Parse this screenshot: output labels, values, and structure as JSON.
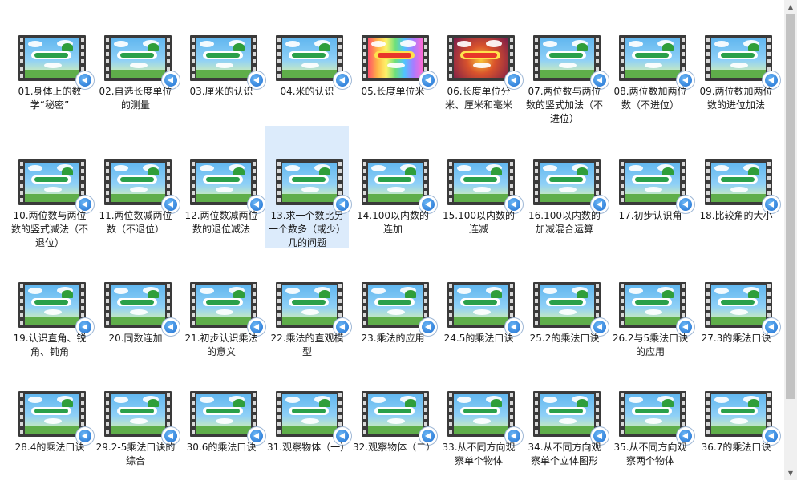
{
  "items": [
    {
      "label": "01.身体上的数学“秘密”",
      "style": "normal"
    },
    {
      "label": "02.自选长度单位的测量",
      "style": "normal"
    },
    {
      "label": "03.厘米的认识",
      "style": "normal"
    },
    {
      "label": "04.米的认识",
      "style": "normal"
    },
    {
      "label": "05.长度单位米",
      "style": "rainbow"
    },
    {
      "label": "06.长度单位分米、厘米和毫米",
      "style": "dark"
    },
    {
      "label": "07.两位数与两位数的竖式加法（不进位）",
      "style": "normal"
    },
    {
      "label": "08.两位数加两位数（不进位）",
      "style": "normal"
    },
    {
      "label": "09.两位数加两位数的进位加法",
      "style": "normal"
    },
    {
      "label": "10.两位数与两位数的竖式减法（不退位）",
      "style": "normal"
    },
    {
      "label": "11.两位数减两位数（不退位）",
      "style": "normal"
    },
    {
      "label": "12.两位数减两位数的退位减法",
      "style": "normal"
    },
    {
      "label": "13.求一个数比另一个数多（或少）几的问题",
      "style": "normal",
      "selected": true
    },
    {
      "label": "14.100以内数的连加",
      "style": "normal"
    },
    {
      "label": "15.100以内数的连减",
      "style": "normal"
    },
    {
      "label": "16.100以内数的加减混合运算",
      "style": "normal"
    },
    {
      "label": "17.初步认识角",
      "style": "normal"
    },
    {
      "label": "18.比较角的大小",
      "style": "normal"
    },
    {
      "label": "19.认识直角、锐角、钝角",
      "style": "normal"
    },
    {
      "label": "20.同数连加",
      "style": "normal"
    },
    {
      "label": "21.初步认识乘法的意义",
      "style": "normal"
    },
    {
      "label": "22.乘法的直观模型",
      "style": "normal"
    },
    {
      "label": "23.乘法的应用",
      "style": "normal"
    },
    {
      "label": "24.5的乘法口诀",
      "style": "normal"
    },
    {
      "label": "25.2的乘法口诀",
      "style": "normal"
    },
    {
      "label": "26.2与5乘法口诀的应用",
      "style": "normal"
    },
    {
      "label": "27.3的乘法口诀",
      "style": "normal"
    },
    {
      "label": "28.4的乘法口诀",
      "style": "normal"
    },
    {
      "label": "29.2-5乘法口诀的综合",
      "style": "normal"
    },
    {
      "label": "30.6的乘法口诀",
      "style": "normal"
    },
    {
      "label": "31.观察物体（一）",
      "style": "normal"
    },
    {
      "label": "32.观察物体（二）",
      "style": "normal"
    },
    {
      "label": "33.从不同方向观察单个物体",
      "style": "normal"
    },
    {
      "label": "34.从不同方向观察单个立体图形",
      "style": "normal"
    },
    {
      "label": "35.从不同方向观察两个物体",
      "style": "normal"
    },
    {
      "label": "36.7的乘法口诀",
      "style": "normal"
    }
  ],
  "scrollbar": {
    "up_arrow": "▲",
    "down_arrow": "▼"
  }
}
